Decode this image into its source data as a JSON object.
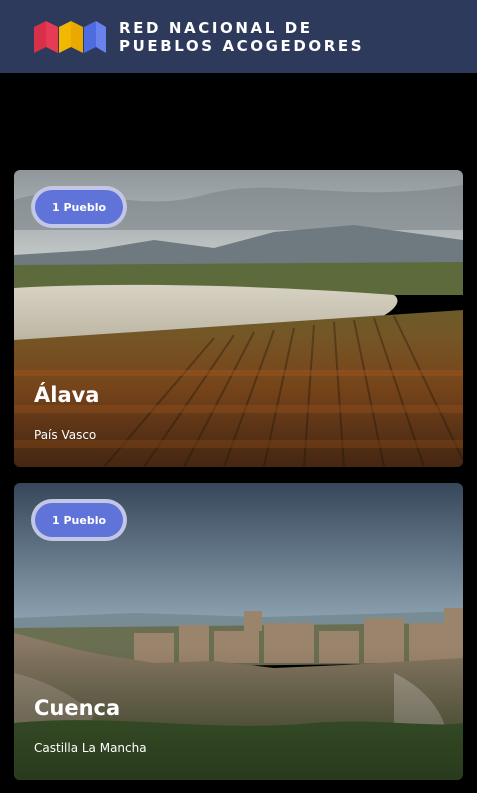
{
  "header": {
    "brand_line1": "RED NACIONAL DE",
    "brand_line2": "PUEBLOS ACOGEDORES",
    "logo_colors": [
      "#d9304a",
      "#f2b800",
      "#4f6be0"
    ]
  },
  "cards": [
    {
      "badge": "1 Pueblo",
      "title": "Álava",
      "region": "País Vasco"
    },
    {
      "badge": "1 Pueblo",
      "title": "Cuenca",
      "region": "Castilla La Mancha"
    }
  ],
  "colors": {
    "header_bg": "#2e3a5c",
    "badge_bg": "#5f73d8"
  }
}
